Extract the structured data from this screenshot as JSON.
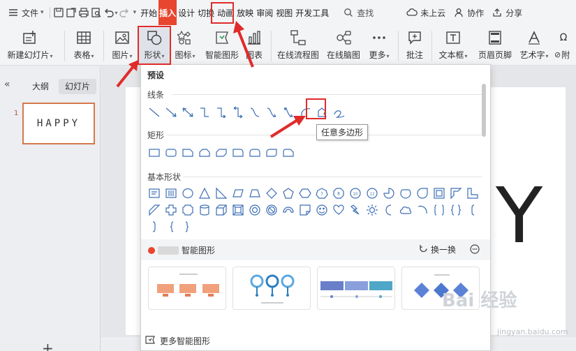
{
  "menubar": {
    "file_label": "文件",
    "tabs": [
      "开始",
      "插入",
      "设计",
      "切换",
      "动画",
      "放映",
      "审阅",
      "视图",
      "开发工具"
    ],
    "active_tab": "插入",
    "search_label": "查找",
    "cloud_label": "未上云",
    "collab_label": "协作",
    "share_label": "分享"
  },
  "ribbon": {
    "new_slide": "新建幻灯片",
    "table": "表格",
    "picture": "图片",
    "shape": "形状",
    "icon": "图标",
    "smart_graphic": "智能图形",
    "chart": "图表",
    "online_flow": "在线流程图",
    "online_mind": "在线脑图",
    "more": "更多",
    "comment": "批注",
    "textbox": "文本框",
    "header_footer": "页眉页脚",
    "art_text": "艺术字",
    "symbol_partial": "符",
    "attach_partial": "附"
  },
  "left_panel": {
    "tab_outline": "大纲",
    "tab_slides": "幻灯片",
    "slide_number": "1",
    "slide_text": "HAPPY",
    "add_label": "+"
  },
  "canvas": {
    "big_letter": "Y"
  },
  "dropdown": {
    "title": "预设",
    "sections": {
      "lines": "线条",
      "rectangles": "矩形",
      "basic": "基本形状"
    },
    "tooltip": "任意多边形",
    "smart_title": "智能图形",
    "refresh_label": "换一换",
    "more_smart": "更多智能图形"
  },
  "watermark": {
    "main": "Bai 经验",
    "sub": "jingyan.baidu.com"
  },
  "colors": {
    "accent": "#e8462f",
    "highlight_box": "#e02b2b",
    "shape_stroke": "#3d6fb5"
  }
}
